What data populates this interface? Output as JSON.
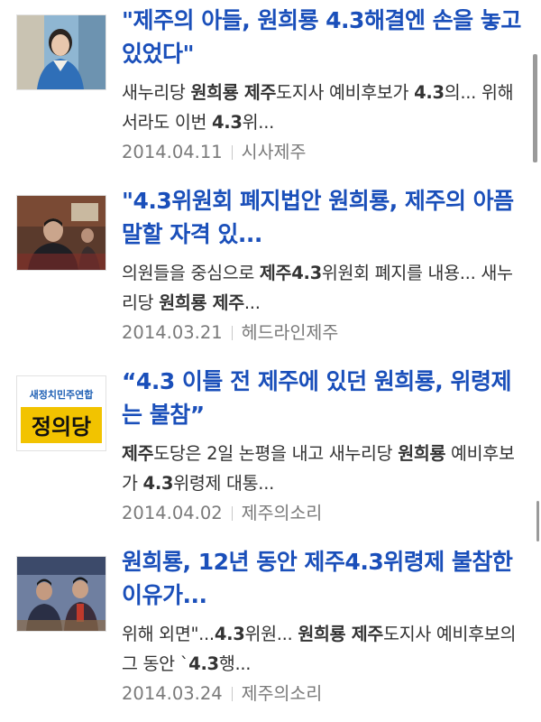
{
  "results": [
    {
      "title": [
        {
          "t": "\"제주",
          "b": true
        },
        {
          "t": "의 아들, ",
          "b": false
        },
        {
          "t": "원희룡 4.3",
          "b": true
        },
        {
          "t": "해결엔 손을 놓고 있었다\"",
          "b": false
        }
      ],
      "snippet": [
        {
          "t": "새누리당 ",
          "b": false
        },
        {
          "t": "원희룡 제주",
          "b": true
        },
        {
          "t": "도지사 예비후보가 ",
          "b": false
        },
        {
          "t": "4.3",
          "b": true
        },
        {
          "t": "의... 위해서라도 이번 ",
          "b": false
        },
        {
          "t": "4.3",
          "b": true
        },
        {
          "t": "위...",
          "b": false
        }
      ],
      "date": "2014.04.11",
      "source": "시사제주",
      "thumb": "woman-portrait"
    },
    {
      "title": [
        {
          "t": "\"4.3",
          "b": true
        },
        {
          "t": "위원회 폐지법안 ",
          "b": false
        },
        {
          "t": "원희룡, 제주",
          "b": true
        },
        {
          "t": "의 아픔 말할 자격 있...",
          "b": false
        }
      ],
      "snippet": [
        {
          "t": "의원들을 중심으로 ",
          "b": false
        },
        {
          "t": "제주4.3",
          "b": true
        },
        {
          "t": "위원회 폐지를 내용... 새누리당 ",
          "b": false
        },
        {
          "t": "원희룡 제주",
          "b": true
        },
        {
          "t": "...",
          "b": false
        }
      ],
      "date": "2014.03.21",
      "source": "헤드라인제주",
      "thumb": "assembly-photo"
    },
    {
      "title": [
        {
          "t": "“4.3 ",
          "b": true
        },
        {
          "t": "이틀 전 ",
          "b": false
        },
        {
          "t": "제주",
          "b": true
        },
        {
          "t": "에 있던 ",
          "b": false
        },
        {
          "t": "원희룡",
          "b": true
        },
        {
          "t": ", 위령제는 불참”",
          "b": false
        }
      ],
      "snippet": [
        {
          "t": "제주",
          "b": true
        },
        {
          "t": "도당은 2일 논평을 내고 새누리당 ",
          "b": false
        },
        {
          "t": "원희룡",
          "b": true
        },
        {
          "t": " 예비후보가 ",
          "b": false
        },
        {
          "t": "4.3",
          "b": true
        },
        {
          "t": "위령제 대통...",
          "b": false
        }
      ],
      "date": "2014.04.02",
      "source": "제주의소리",
      "thumb": "party-logo",
      "thumb_text_top": "새정치민주연합",
      "thumb_text_main": "정의당"
    },
    {
      "title": [
        {
          "t": "원희룡",
          "b": true
        },
        {
          "t": ", 12년 동안 ",
          "b": false
        },
        {
          "t": "제주4.3",
          "b": true
        },
        {
          "t": "위령제 불참한 이유가...",
          "b": false
        }
      ],
      "snippet": [
        {
          "t": "위해 외면\"...",
          "b": false
        },
        {
          "t": "4.3",
          "b": true
        },
        {
          "t": "위원... ",
          "b": false
        },
        {
          "t": "원희룡 제주",
          "b": true
        },
        {
          "t": "도지사 예비후보의 그 동안 `",
          "b": false
        },
        {
          "t": "4.3",
          "b": true
        },
        {
          "t": "행...",
          "b": false
        }
      ],
      "date": "2014.03.24",
      "source": "제주의소리",
      "thumb": "two-men-photo"
    }
  ],
  "colors": {
    "title": "#1a4fba",
    "snippet": "#333333",
    "meta": "#7a7a7a",
    "party_logo_bg": "#f2c300",
    "party_logo_top_text": "#1d5fb4"
  }
}
